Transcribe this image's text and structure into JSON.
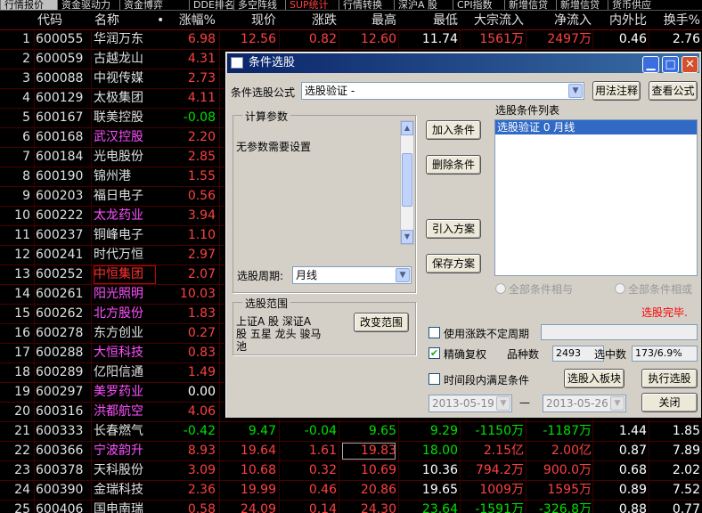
{
  "tabs": [
    {
      "label": "行情报价",
      "active": true
    },
    {
      "label": "资金驱动力"
    },
    {
      "label": "资金博弈"
    },
    {
      "label": "DDE排名"
    },
    {
      "label": "多空阵线"
    },
    {
      "label": "SUP统计",
      "highlight": true
    },
    {
      "label": "行情转换"
    },
    {
      "label": "深沪A 股"
    },
    {
      "label": "CPI指数"
    },
    {
      "label": "新增信贷"
    },
    {
      "label": "新增信贷"
    },
    {
      "label": "货币供应"
    }
  ],
  "columns": [
    "代码",
    "名称",
    "•",
    "涨幅%",
    "现价",
    "涨跌",
    "最高",
    "最低",
    "大宗流入",
    "净流入",
    "内外比",
    "换手%"
  ],
  "rows": [
    {
      "n": "1",
      "code": "600055",
      "name": "华润万东",
      "nc": "#e0e0e0",
      "chg": "6.98",
      "price": "12.56",
      "diff": "0.82",
      "high": "12.60",
      "low": "11.74",
      "big": "1561万",
      "net": "2497万",
      "ratio": "0.46",
      "turn": "2.76"
    },
    {
      "n": "2",
      "code": "600059",
      "name": "古越龙山",
      "nc": "#e0e0e0",
      "chg": "4.31"
    },
    {
      "n": "3",
      "code": "600088",
      "name": "中视传媒",
      "nc": "#e0e0e0",
      "chg": "2.73"
    },
    {
      "n": "4",
      "code": "600129",
      "name": "太极集团",
      "nc": "#e0e0e0",
      "chg": "4.11"
    },
    {
      "n": "5",
      "code": "600167",
      "name": "联美控股",
      "nc": "#e0e0e0",
      "chg": "-0.08"
    },
    {
      "n": "6",
      "code": "600168",
      "name": "武汉控股",
      "nc": "#ff50ff",
      "chg": "2.20"
    },
    {
      "n": "7",
      "code": "600184",
      "name": "光电股份",
      "nc": "#e0e0e0",
      "chg": "2.85"
    },
    {
      "n": "8",
      "code": "600190",
      "name": "锦州港",
      "nc": "#e0e0e0",
      "chg": "1.55"
    },
    {
      "n": "9",
      "code": "600203",
      "name": "福日电子",
      "nc": "#e0e0e0",
      "chg": "0.56"
    },
    {
      "n": "10",
      "code": "600222",
      "name": "太龙药业",
      "nc": "#ff50ff",
      "chg": "3.94"
    },
    {
      "n": "11",
      "code": "600237",
      "name": "铜峰电子",
      "nc": "#e0e0e0",
      "chg": "1.10"
    },
    {
      "n": "12",
      "code": "600241",
      "name": "时代万恒",
      "nc": "#e0e0e0",
      "chg": "2.97"
    },
    {
      "n": "13",
      "code": "600252",
      "name": "中恒集团",
      "nc": "#ff3030",
      "chg": "2.07",
      "boxed": true
    },
    {
      "n": "14",
      "code": "600261",
      "name": "阳光照明",
      "nc": "#ff50ff",
      "chg": "10.03"
    },
    {
      "n": "15",
      "code": "600262",
      "name": "北方股份",
      "nc": "#ff50ff",
      "chg": "1.83"
    },
    {
      "n": "16",
      "code": "600278",
      "name": "东方创业",
      "nc": "#e0e0e0",
      "chg": "0.27"
    },
    {
      "n": "17",
      "code": "600288",
      "name": "大恒科技",
      "nc": "#ff50ff",
      "chg": "0.83"
    },
    {
      "n": "18",
      "code": "600289",
      "name": "亿阳信通",
      "nc": "#e0e0e0",
      "chg": "1.49"
    },
    {
      "n": "19",
      "code": "600297",
      "name": "美罗药业",
      "nc": "#ff50ff",
      "chg": "0.00"
    },
    {
      "n": "20",
      "code": "600316",
      "name": "洪都航空",
      "nc": "#ff50ff",
      "chg": "4.06"
    },
    {
      "n": "21",
      "code": "600333",
      "name": "长春燃气",
      "nc": "#e0e0e0",
      "chg": "-0.42",
      "price": "9.47",
      "diff": "-0.04",
      "high": "9.65",
      "low": "9.29",
      "big": "-1150万",
      "net": "-1187万",
      "ratio": "1.44",
      "turn": "1.85"
    },
    {
      "n": "22",
      "code": "600366",
      "name": "宁波韵升",
      "nc": "#ff50ff",
      "chg": "8.93",
      "price": "19.64",
      "diff": "1.61",
      "high": "19.83",
      "low": "18.00",
      "big": "2.15亿",
      "net": "2.00亿",
      "ratio": "0.87",
      "turn": "7.89",
      "boxhigh": true
    },
    {
      "n": "23",
      "code": "600378",
      "name": "天科股份",
      "nc": "#e0e0e0",
      "chg": "3.09",
      "price": "10.68",
      "diff": "0.32",
      "high": "10.69",
      "low": "10.36",
      "big": "794.2万",
      "net": "900.0万",
      "ratio": "0.68",
      "turn": "2.02"
    },
    {
      "n": "24",
      "code": "600390",
      "name": "金瑞科技",
      "nc": "#e0e0e0",
      "chg": "2.36",
      "price": "19.99",
      "diff": "0.46",
      "high": "20.86",
      "low": "19.65",
      "big": "1009万",
      "net": "1595万",
      "ratio": "0.89",
      "turn": "7.52"
    },
    {
      "n": "25",
      "code": "600406",
      "name": "国电南瑞",
      "nc": "#e0e0e0",
      "chg": "0.58",
      "price": "24.09",
      "diff": "0.14",
      "high": "24.30",
      "low": "23.64",
      "big": "-1591万",
      "net": "-326.8万",
      "ratio": "0.88",
      "turn": "0.77"
    }
  ],
  "dialog": {
    "title": "条件选股",
    "formula_label": "条件选股公式",
    "formula_value": "选股验证 -",
    "usage_btn": "用法注释",
    "view_btn": "查看公式",
    "params_group": "计算参数",
    "params_text": "无参数需要设置",
    "period_label": "选股周期:",
    "period_value": "月线",
    "add_btn": "加入条件",
    "del_btn": "删除条件",
    "import_btn": "引入方案",
    "save_btn": "保存方案",
    "list_label": "选股条件列表",
    "list_items": [
      "选股验证  0  月线"
    ],
    "radio_and": "全部条件相与",
    "radio_or": "全部条件相或",
    "status": "选股完毕.",
    "range_group": "选股范围",
    "range_text": "上证A 股 深证A 股 五星 龙头 骏马池",
    "change_range_btn": "改变范围",
    "chk_unfixed": "使用涨跌不定周期",
    "chk_exact": "精确复权",
    "count_label": "品种数",
    "count_value": "2493",
    "selected_label": "选中数",
    "selected_value": "173/6.9%",
    "chk_time": "时间段内满足条件",
    "to_block_btn": "选股入板块",
    "exec_btn": "执行选股",
    "date_from": "2013-05-19",
    "date_dash": "—",
    "date_to": "2013-05-26",
    "close_btn": "关闭"
  },
  "colors": {
    "up": "#ff4040",
    "down": "#00e000",
    "flat": "#ffffff",
    "code": "#e0e0e0",
    "yellow": "#ffff60"
  }
}
